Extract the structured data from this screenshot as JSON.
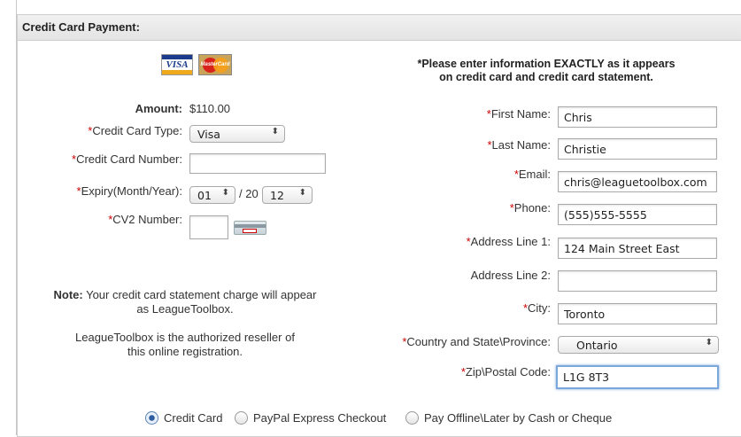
{
  "header": {
    "title": "Credit Card Payment:"
  },
  "instructions": {
    "line1": "*Please enter information EXACTLY as it appears",
    "line2": "on credit card and credit card statement."
  },
  "cards": {
    "visa_text": "VISA",
    "mastercard_text": "MasterCard"
  },
  "left_form": {
    "amount_label": "Amount:",
    "amount_value": "$110.00",
    "card_type_label": "Credit Card Type:",
    "card_type_value": "Visa",
    "card_number_label": "Credit Card Number:",
    "card_number_value": "",
    "expiry_label": "Expiry(Month/Year):",
    "expiry_month": "01",
    "expiry_sep": "/ 20",
    "expiry_year": "12",
    "cv2_label": "CV2 Number:",
    "cv2_value": ""
  },
  "notes": {
    "note_bold": "Note:",
    "note_line1_rest": " Your credit card statement charge will appear",
    "note_line2": "as LeagueToolbox.",
    "reseller_line1": "LeagueToolbox is the authorized reseller of",
    "reseller_line2": "this online registration."
  },
  "right_form": {
    "first_name_label": "First Name:",
    "first_name_value": "Chris",
    "last_name_label": "Last Name:",
    "last_name_value": "Christie",
    "email_label": "Email:",
    "email_value": "chris@leaguetoolbox.com",
    "phone_label": "Phone:",
    "phone_value": "(555)555-5555",
    "address1_label": "Address Line 1:",
    "address1_value": "124 Main Street East",
    "address2_label": "Address Line 2:",
    "address2_value": "",
    "city_label": "City:",
    "city_value": "Toronto",
    "country_label": "Country and State\\Province:",
    "country_value": "Ontario",
    "zip_label": "Zip\\Postal Code:",
    "zip_value": "L1G 8T3"
  },
  "payment_options": [
    {
      "label": "Credit Card",
      "selected": true
    },
    {
      "label": "PayPal Express Checkout",
      "selected": false
    },
    {
      "label": "Pay Offline\\Later by Cash or Cheque",
      "selected": false
    }
  ],
  "required_marker": "*"
}
